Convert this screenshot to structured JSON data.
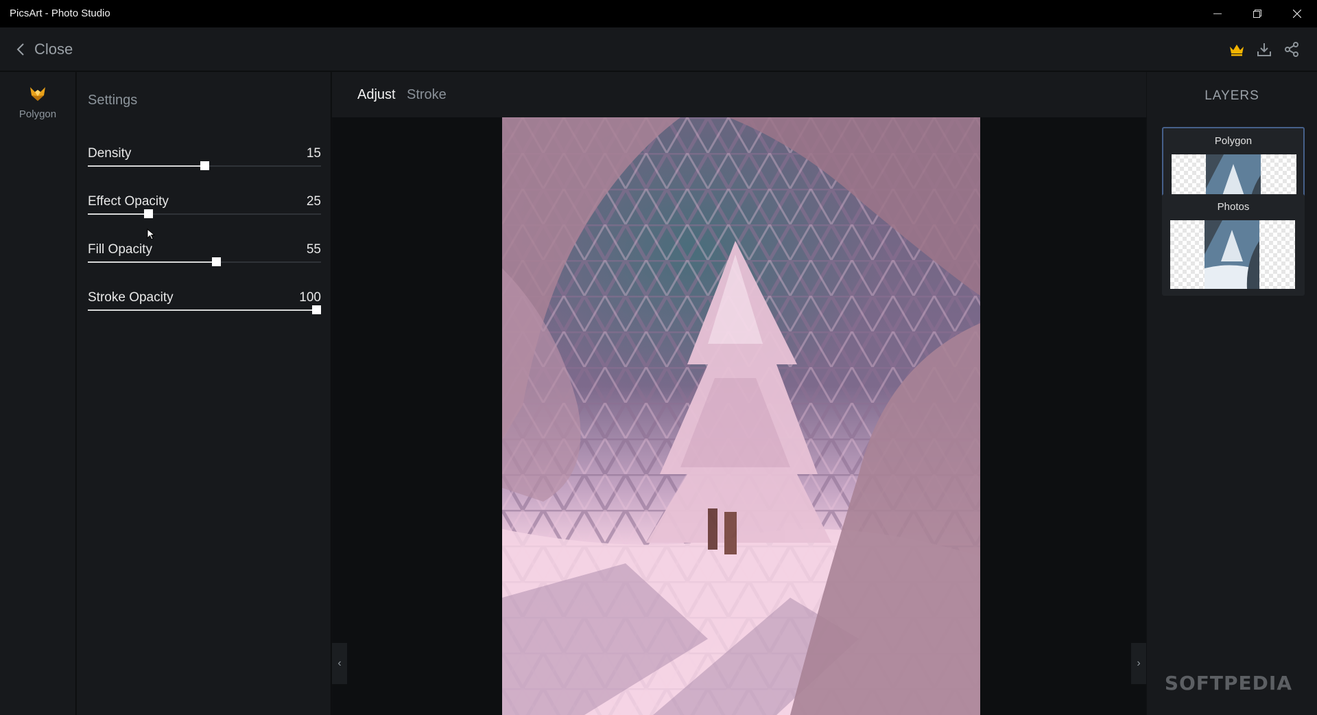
{
  "window": {
    "title": "PicsArt - Photo Studio"
  },
  "appbar": {
    "close_label": "Close"
  },
  "rail": {
    "tool_label": "Polygon"
  },
  "settings": {
    "heading": "Settings",
    "sliders": [
      {
        "label": "Density",
        "value": "15",
        "fraction": 0.5
      },
      {
        "label": "Effect Opacity",
        "value": "25",
        "fraction": 0.26
      },
      {
        "label": "Fill Opacity",
        "value": "55",
        "fraction": 0.55
      },
      {
        "label": "Stroke Opacity",
        "value": "100",
        "fraction": 0.98
      }
    ]
  },
  "tabs": {
    "adjust": "Adjust",
    "stroke": "Stroke",
    "active": "adjust"
  },
  "layers": {
    "heading": "LAYERS",
    "items": [
      {
        "name": "Polygon",
        "selected": true
      },
      {
        "name": "Photos",
        "selected": false
      }
    ]
  },
  "watermark": "SOFTPEDIA",
  "colors": {
    "accent_crown": "#f4b400",
    "selection_border": "#46608a",
    "panel": "#17191c",
    "photo_tint": "#c9a2b7"
  }
}
